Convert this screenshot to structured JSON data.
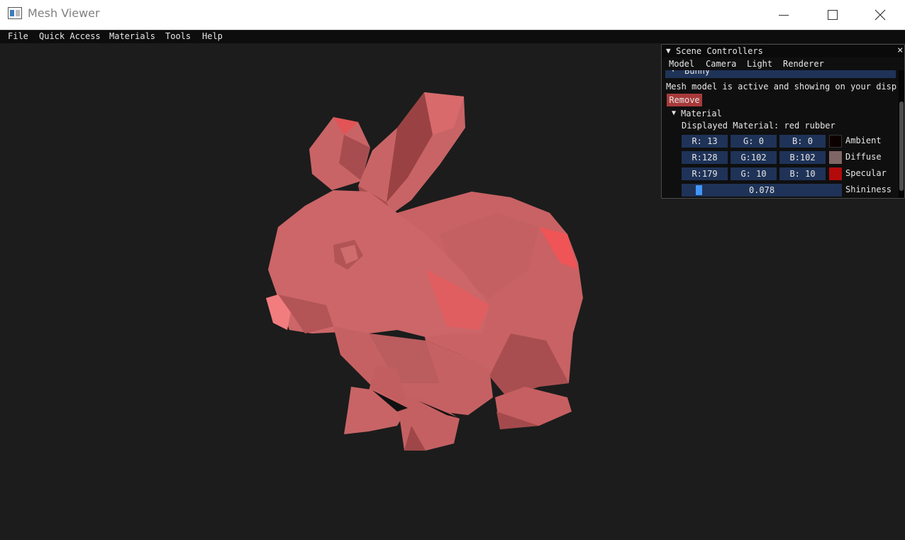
{
  "window": {
    "title": "Mesh Viewer"
  },
  "menu": {
    "file": "File",
    "quick_access": "Quick Access",
    "materials": "Materials",
    "tools": "Tools",
    "help": "Help"
  },
  "panel": {
    "title": "Scene Controllers",
    "tabs": {
      "model": "Model",
      "camera": "Camera",
      "light": "Light",
      "renderer": "Renderer"
    },
    "model_header": "Bunny",
    "status_text": "Mesh model is active and showing on your display",
    "remove_label": "Remove",
    "material_header": "Material",
    "displayed_material": "Displayed Material: red rubber",
    "rows": {
      "ambient": {
        "r": "R: 13",
        "g": "G:  0",
        "b": "B:  0",
        "label": "Ambient",
        "color": "#0d0000"
      },
      "diffuse": {
        "r": "R:128",
        "g": "G:102",
        "b": "B:102",
        "label": "Diffuse",
        "color": "#806666"
      },
      "specular": {
        "r": "R:179",
        "g": "G: 10",
        "b": "B: 10",
        "label": "Specular",
        "color": "#b30a0a"
      }
    },
    "shininess": {
      "value_text": "0.078",
      "label": "Shininess",
      "value": 0.078
    }
  },
  "colors": {
    "panel_bg": "#0f0f0f",
    "field_bg": "#1f3358",
    "accent": "#4296fa",
    "remove_bg": "#a83a3a",
    "viewport_bg": "#1c1c1c"
  }
}
